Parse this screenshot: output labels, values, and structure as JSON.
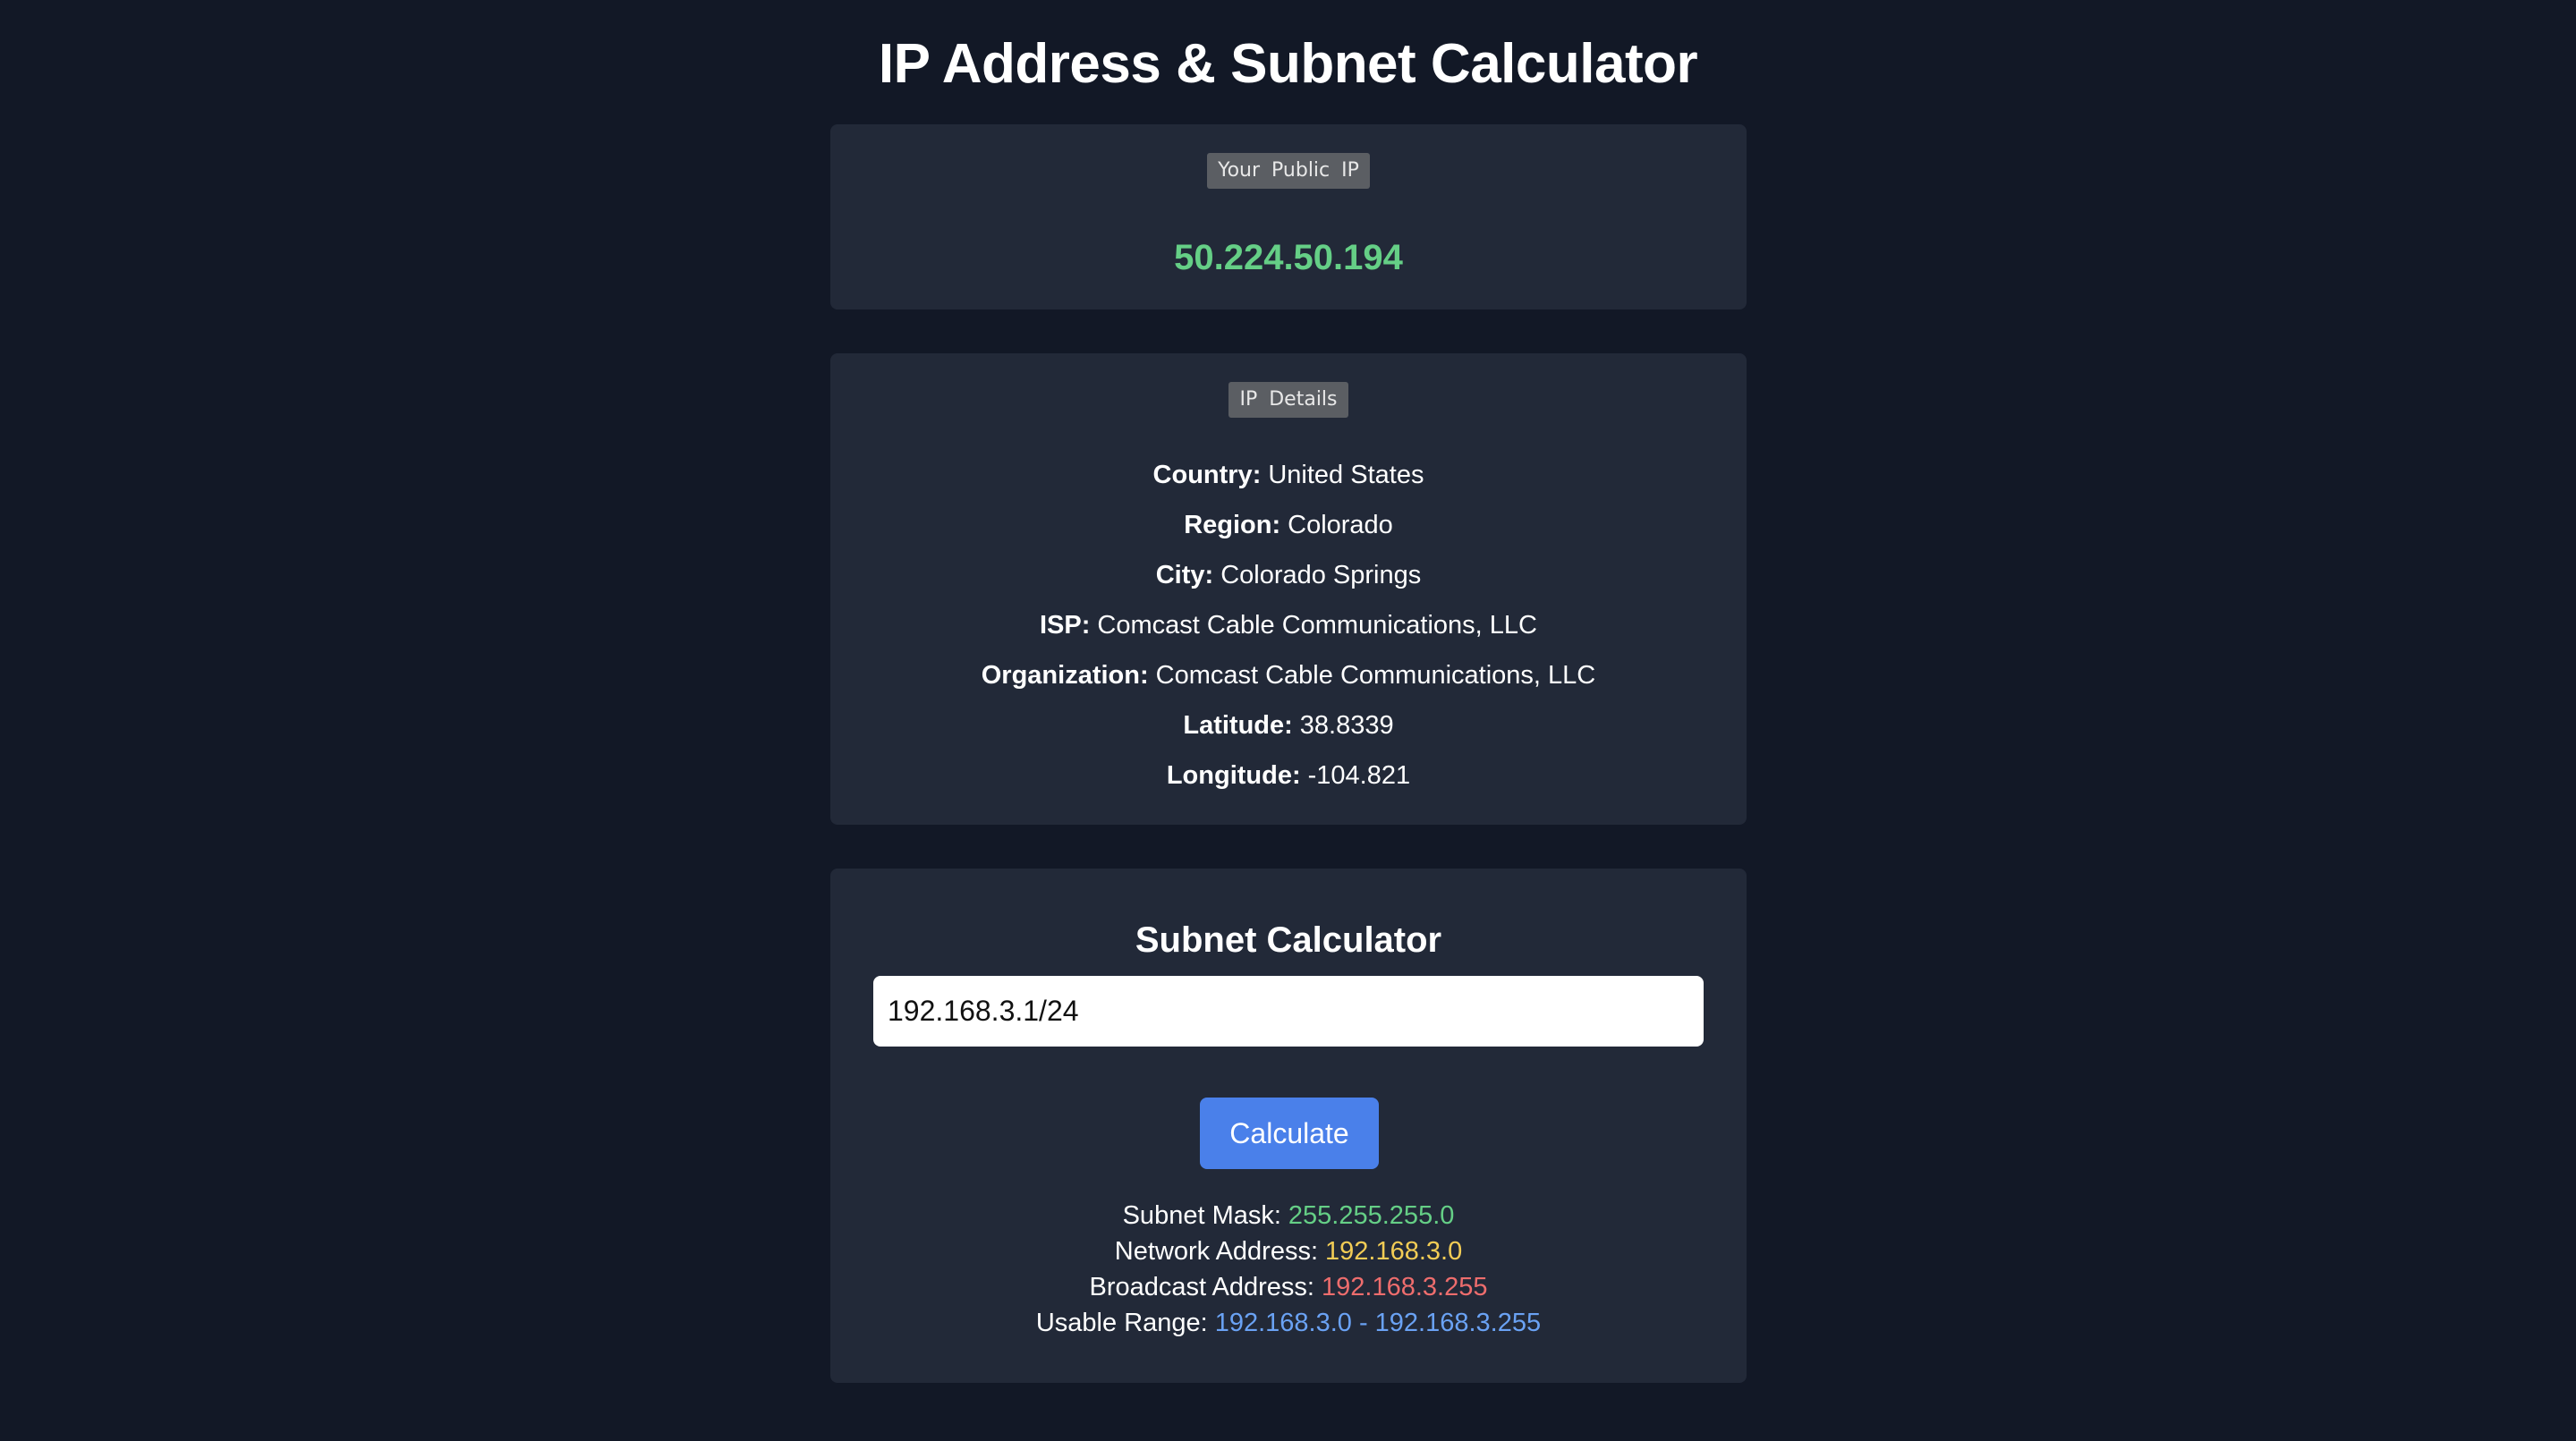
{
  "page_title": "IP Address & Subnet Calculator",
  "public_ip_card": {
    "badge": "Your Public IP",
    "ip": "50.224.50.194"
  },
  "ip_details": {
    "badge": "IP Details",
    "rows": [
      {
        "label": "Country:",
        "value": "United States"
      },
      {
        "label": "Region:",
        "value": "Colorado"
      },
      {
        "label": "City:",
        "value": "Colorado Springs"
      },
      {
        "label": "ISP:",
        "value": "Comcast Cable Communications, LLC"
      },
      {
        "label": "Organization:",
        "value": "Comcast Cable Communications, LLC"
      },
      {
        "label": "Latitude:",
        "value": "38.8339"
      },
      {
        "label": "Longitude:",
        "value": "-104.821"
      }
    ]
  },
  "subnet_calculator": {
    "title": "Subnet Calculator",
    "input_value": "192.168.3.1/24",
    "button_label": "Calculate",
    "results": {
      "subnet_mask": {
        "label": "Subnet Mask:",
        "value": "255.255.255.0"
      },
      "network_address": {
        "label": "Network Address:",
        "value": "192.168.3.0"
      },
      "broadcast_address": {
        "label": "Broadcast Address:",
        "value": "192.168.3.255"
      },
      "usable_range": {
        "label": "Usable Range:",
        "value": "192.168.3.0 - 192.168.3.255"
      }
    }
  },
  "colors": {
    "background": "#121826",
    "card": "#222938",
    "accent_green": "#65cf86",
    "accent_yellow": "#f2cc55",
    "accent_red": "#ee6d6d",
    "accent_blue": "#6aa2f4",
    "button": "#4a80ea"
  }
}
